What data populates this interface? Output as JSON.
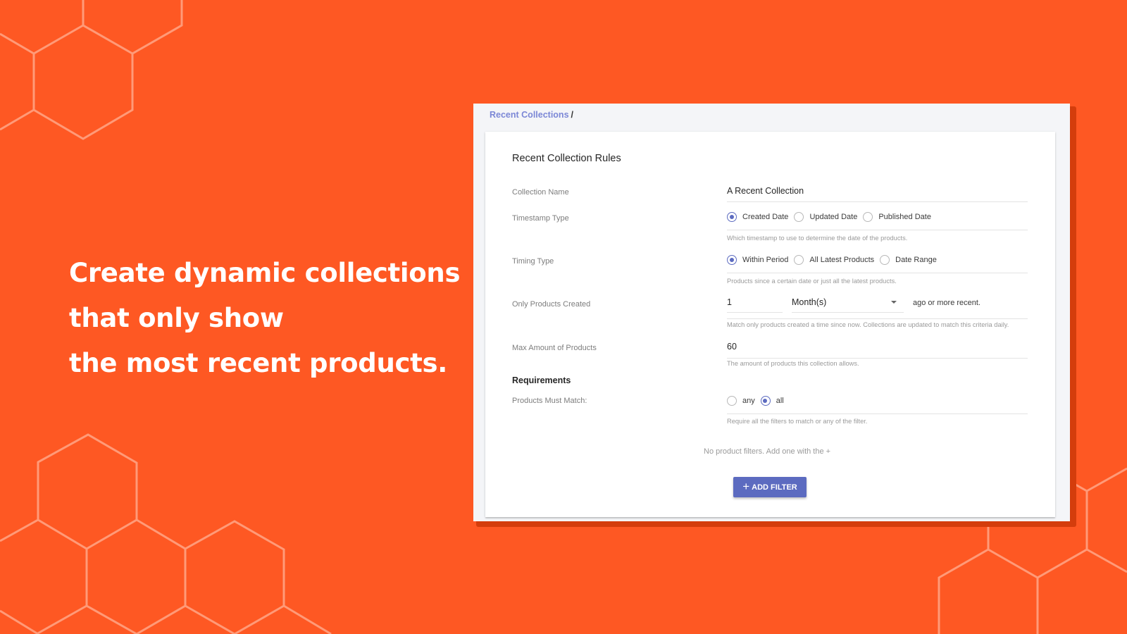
{
  "headline": {
    "lines": [
      "Create dynamic collections",
      "that only show",
      "the most recent products."
    ]
  },
  "colors": {
    "background": "#fe5823",
    "hex_stroke": "#ff9a78",
    "window_shadow": "#d43d0c",
    "accent": "#5c6bc0",
    "breadcrumb_link": "#7b87d6"
  },
  "app": {
    "breadcrumb": {
      "link": "Recent Collections",
      "separator": "/"
    },
    "card_title": "Recent Collection Rules",
    "fields": {
      "collection_name": {
        "label": "Collection Name",
        "value": "A Recent Collection"
      },
      "timestamp_type": {
        "label": "Timestamp Type",
        "options": [
          "Created Date",
          "Updated Date",
          "Published Date"
        ],
        "selected": "Created Date",
        "hint": "Which timestamp to use to determine the date of the products."
      },
      "timing_type": {
        "label": "Timing Type",
        "options": [
          "Within Period",
          "All Latest Products",
          "Date Range"
        ],
        "selected": "Within Period",
        "hint": "Products since a certain date or just all the latest products."
      },
      "only_products_created": {
        "label": "Only Products Created",
        "amount": "1",
        "unit": "Month(s)",
        "suffix": "ago or more recent.",
        "hint": "Match only products created a time since now. Collections are updated to match this criteria daily."
      },
      "max_amount": {
        "label": "Max Amount of Products",
        "value": "60",
        "hint": "The amount of products this collection allows."
      }
    },
    "requirements": {
      "title": "Requirements",
      "must_match": {
        "label": "Products Must Match:",
        "options": [
          "any",
          "all"
        ],
        "selected": "all",
        "hint": "Require all the filters to match or any of the filter."
      },
      "empty_message": "No product filters. Add one with the +",
      "add_filter_icon": "plus-icon",
      "add_filter_label": "ADD FILTER"
    }
  }
}
